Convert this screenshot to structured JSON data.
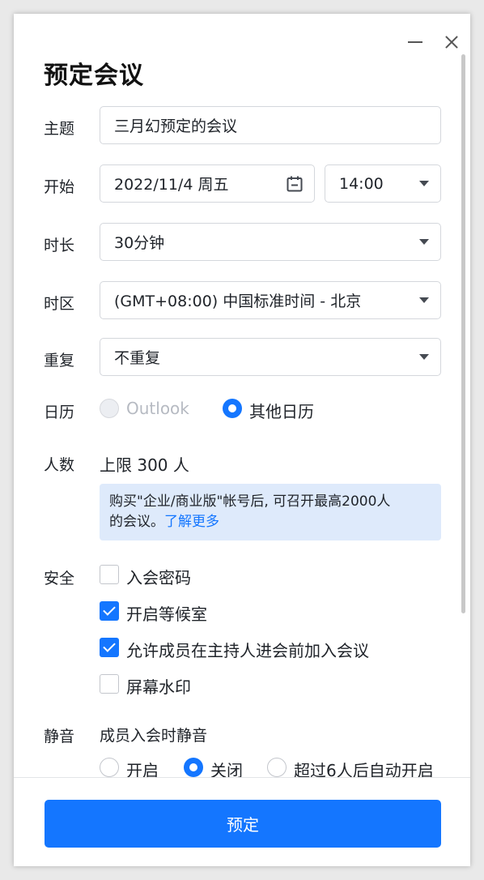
{
  "dialog": {
    "title": "预定会议"
  },
  "topic": {
    "label": "主题",
    "value": "三月幻预定的会议"
  },
  "start": {
    "label": "开始",
    "date": "2022/11/4 周五",
    "time": "14:00"
  },
  "duration": {
    "label": "时长",
    "value": "30分钟"
  },
  "timezone": {
    "label": "时区",
    "value": "(GMT+08:00) 中国标准时间 - 北京"
  },
  "repeat": {
    "label": "重复",
    "value": "不重复"
  },
  "calendar": {
    "label": "日历",
    "options": [
      {
        "label": "Outlook",
        "selected": false,
        "disabled": true
      },
      {
        "label": "其他日历",
        "selected": true,
        "disabled": false
      }
    ]
  },
  "capacity": {
    "label": "人数",
    "value": "上限 300 人",
    "info_line1": "购买\"企业/商业版\"帐号后, 可召开最高2000人",
    "info_line2": "的会议。",
    "info_link": "了解更多"
  },
  "security": {
    "label": "安全",
    "options": [
      {
        "label": "入会密码",
        "checked": false
      },
      {
        "label": "开启等候室",
        "checked": true
      },
      {
        "label": "允许成员在主持人进会前加入会议",
        "checked": true
      },
      {
        "label": "屏幕水印",
        "checked": false
      }
    ]
  },
  "mute": {
    "label": "静音",
    "sublabel": "成员入会时静音",
    "options": [
      {
        "label": "开启",
        "selected": false
      },
      {
        "label": "关闭",
        "selected": true
      },
      {
        "label": "超过6人后自动开启",
        "selected": false
      }
    ]
  },
  "footer": {
    "submit_label": "预定"
  },
  "colors": {
    "accent": "#1476ff",
    "info_bg": "#deeafb",
    "border": "#d4d7dc"
  },
  "icons": {
    "calendar": "calendar-icon",
    "minimize": "minimize-icon",
    "close": "close-icon",
    "dropdown": "chevron-down-icon"
  }
}
